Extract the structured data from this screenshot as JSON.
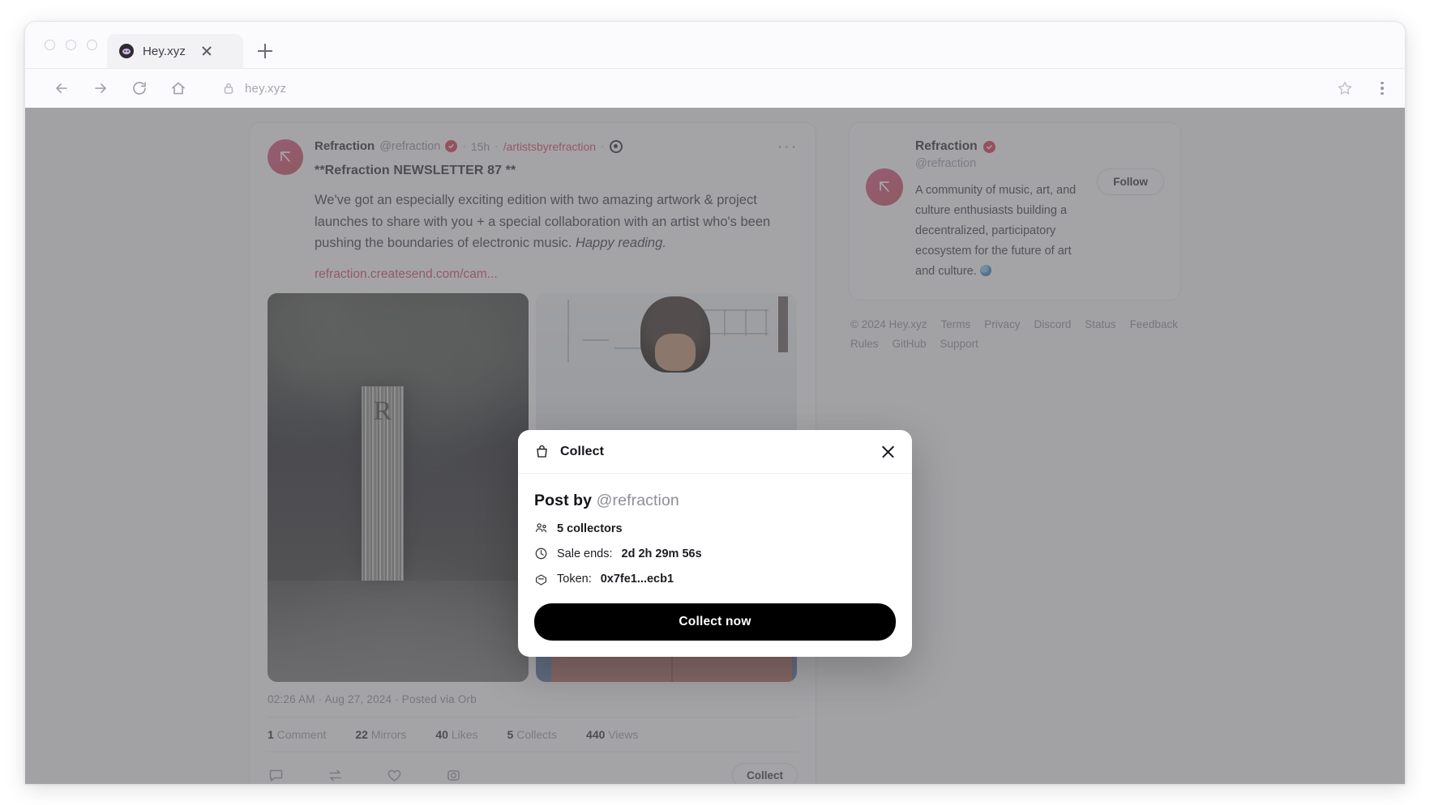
{
  "browser": {
    "tab": {
      "title": "Hey.xyz",
      "favicon_icon": "hey-logo-icon",
      "close_icon": "close-icon"
    },
    "new_tab_icon": "plus-icon",
    "nav": {
      "back_icon": "arrow-back-icon",
      "forward_icon": "arrow-forward-icon",
      "reload_icon": "reload-icon",
      "home_icon": "home-icon",
      "lock_icon": "lock-icon",
      "url": "hey.xyz",
      "bookmark_icon": "star-icon",
      "menu_icon": "kebab-menu-icon"
    }
  },
  "post": {
    "author_name": "Refraction",
    "author_handle": "@refraction",
    "verified_icon": "verified-badge-icon",
    "time": "15h",
    "community": "/artistsbyrefraction",
    "source_icon": "orb-source-icon",
    "more_icon": "more-options-icon",
    "title": "**Refraction NEWSLETTER 87 **",
    "body_1": "We've got an especially exciting edition with two amazing artwork & project launches to share with you + a special collaboration with an artist who's been pushing the boundaries of electronic music. ",
    "body_italic": "Happy reading.",
    "link": "refraction.createsend.com/cam...",
    "timestamp": "02:26 AM · Aug 27, 2024 · Posted via Orb",
    "stats": [
      {
        "count": "1",
        "label": "Comment"
      },
      {
        "count": "22",
        "label": "Mirrors"
      },
      {
        "count": "40",
        "label": "Likes"
      },
      {
        "count": "5",
        "label": "Collects"
      },
      {
        "count": "440",
        "label": "Views"
      }
    ],
    "actions": {
      "comment_icon": "comment-icon",
      "mirror_icon": "mirror-repost-icon",
      "like_icon": "heart-like-icon",
      "collect_icon": "collect-icon",
      "collect_label": "Collect"
    },
    "attachment_1_alt": "monochrome photo of striped sculpture with R logo",
    "attachment_2_alt": "photo of person with curly hair above architectural render"
  },
  "sidebar": {
    "profile": {
      "name": "Refraction",
      "verified_icon": "verified-badge-icon",
      "handle": "@refraction",
      "bio": "A community of music, art, and culture enthusiasts building a decentralized, participatory ecosystem for the future of art and culture.",
      "bio_emoji": "globe-emoji-icon",
      "follow_label": "Follow"
    },
    "footer": {
      "copyright": "© 2024 Hey.xyz",
      "links_row_1": [
        "Terms",
        "Privacy",
        "Discord",
        "Status",
        "Feedback"
      ],
      "links_row_2": [
        "Rules",
        "GitHub",
        "Support"
      ]
    }
  },
  "modal": {
    "header_icon": "shopping-bag-icon",
    "title": "Collect",
    "close_icon": "close-icon",
    "post_by_prefix": "Post by ",
    "post_by_handle": "@refraction",
    "collectors_icon": "collectors-users-icon",
    "collectors": "5 collectors",
    "sale_icon": "clock-icon",
    "sale_label": "Sale ends:",
    "sale_value": "2d 2h 29m 56s",
    "token_icon": "token-icon",
    "token_label": "Token:",
    "token_value": "0x7fe1...ecb1",
    "cta_label": "Collect now"
  },
  "colors": {
    "accent_pink": "#e0586e",
    "cta_black": "#000000",
    "overlay": "rgba(90,90,95,0.55)"
  }
}
